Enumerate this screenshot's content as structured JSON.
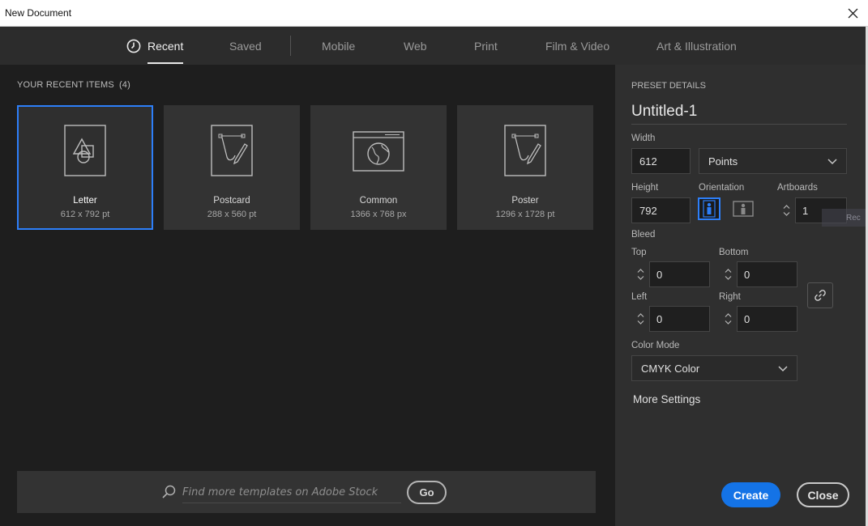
{
  "window": {
    "title": "New Document"
  },
  "tabs": [
    {
      "label": "Recent",
      "active": true,
      "icon": "clock-icon"
    },
    {
      "label": "Saved"
    },
    {
      "label": "Mobile"
    },
    {
      "label": "Web"
    },
    {
      "label": "Print"
    },
    {
      "label": "Film & Video"
    },
    {
      "label": "Art & Illustration"
    }
  ],
  "recent": {
    "heading": "YOUR RECENT ITEMS",
    "count": "(4)",
    "items": [
      {
        "name": "Letter",
        "size": "612 x 792 pt",
        "icon": "shapes-doc-icon",
        "selected": true
      },
      {
        "name": "Postcard",
        "size": "288 x 560 pt",
        "icon": "pen-doc-icon"
      },
      {
        "name": "Common",
        "size": "1366 x 768 px",
        "icon": "web-globe-icon"
      },
      {
        "name": "Poster",
        "size": "1296 x 1728 pt",
        "icon": "pen-doc-icon"
      }
    ]
  },
  "search": {
    "placeholder": "Find more templates on Adobe Stock",
    "go_label": "Go"
  },
  "preset": {
    "heading": "PRESET DETAILS",
    "doc_name": "Untitled-1",
    "width_label": "Width",
    "width": "612",
    "units": "Points",
    "height_label": "Height",
    "height": "792",
    "orientation_label": "Orientation",
    "artboards_label": "Artboards",
    "artboards": "1",
    "bleed_label": "Bleed",
    "top_label": "Top",
    "top": "0",
    "bottom_label": "Bottom",
    "bottom": "0",
    "left_label": "Left",
    "left": "0",
    "right_label": "Right",
    "right": "0",
    "color_mode_label": "Color Mode",
    "color_mode": "CMYK Color",
    "more_settings": "More Settings",
    "create_label": "Create",
    "close_label": "Close"
  },
  "ghost_text": "Rec",
  "colors": {
    "accent": "#2d7ff9",
    "create_button": "#1473e6",
    "panel": "#2f2f2f",
    "canvas": "#1e1e1e"
  }
}
